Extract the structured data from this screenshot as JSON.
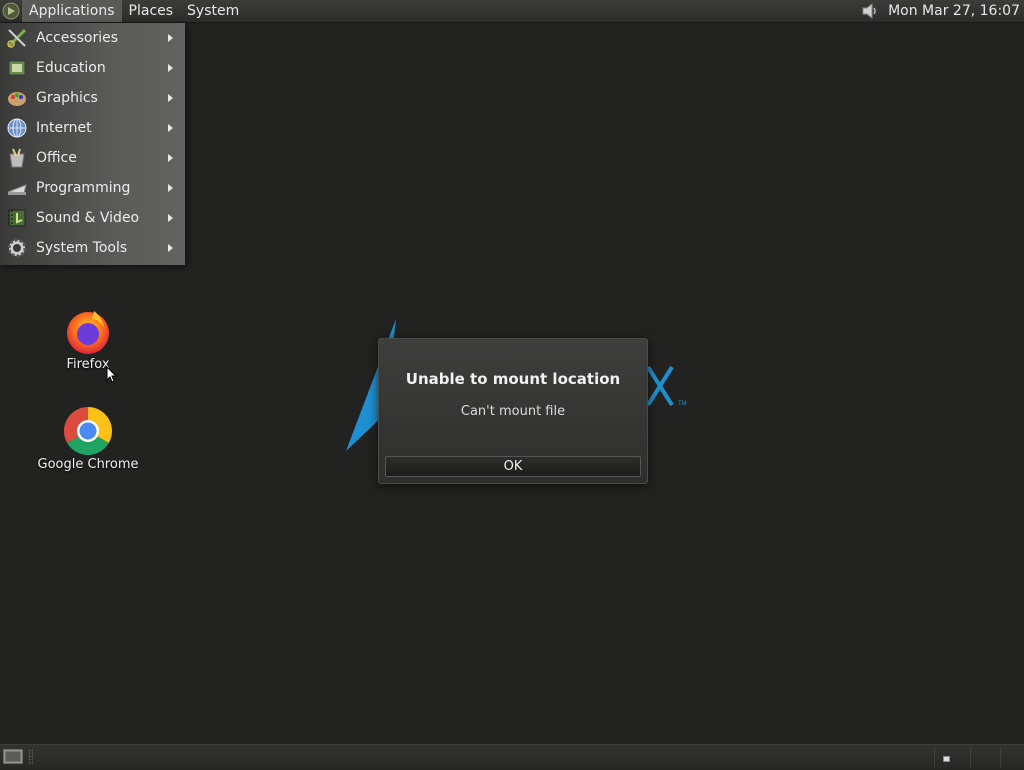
{
  "top_panel": {
    "menus": [
      {
        "label": "Applications"
      },
      {
        "label": "Places"
      },
      {
        "label": "System"
      }
    ],
    "clock": "Mon Mar 27, 16:07",
    "volume_icon": "speaker-icon"
  },
  "app_menu": {
    "items": [
      {
        "label": "Accessories",
        "icon": "accessories-icon"
      },
      {
        "label": "Education",
        "icon": "education-icon"
      },
      {
        "label": "Graphics",
        "icon": "graphics-icon"
      },
      {
        "label": "Internet",
        "icon": "globe-icon"
      },
      {
        "label": "Office",
        "icon": "office-icon"
      },
      {
        "label": "Programming",
        "icon": "programming-icon"
      },
      {
        "label": "Sound & Video",
        "icon": "sound-video-icon"
      },
      {
        "label": "System Tools",
        "icon": "gear-icon"
      }
    ]
  },
  "desktop": {
    "icons": [
      {
        "label": "Firefox",
        "icon": "firefox-icon"
      },
      {
        "label": "Google Chrome",
        "icon": "chrome-icon"
      }
    ]
  },
  "dialog": {
    "title": "Unable to mount location",
    "message": "Can't mount file",
    "ok_label": "OK"
  },
  "colors": {
    "desktop_bg": "#222321",
    "menu_active": "#5a5b59",
    "logo_blue": "#1e8fd0"
  }
}
